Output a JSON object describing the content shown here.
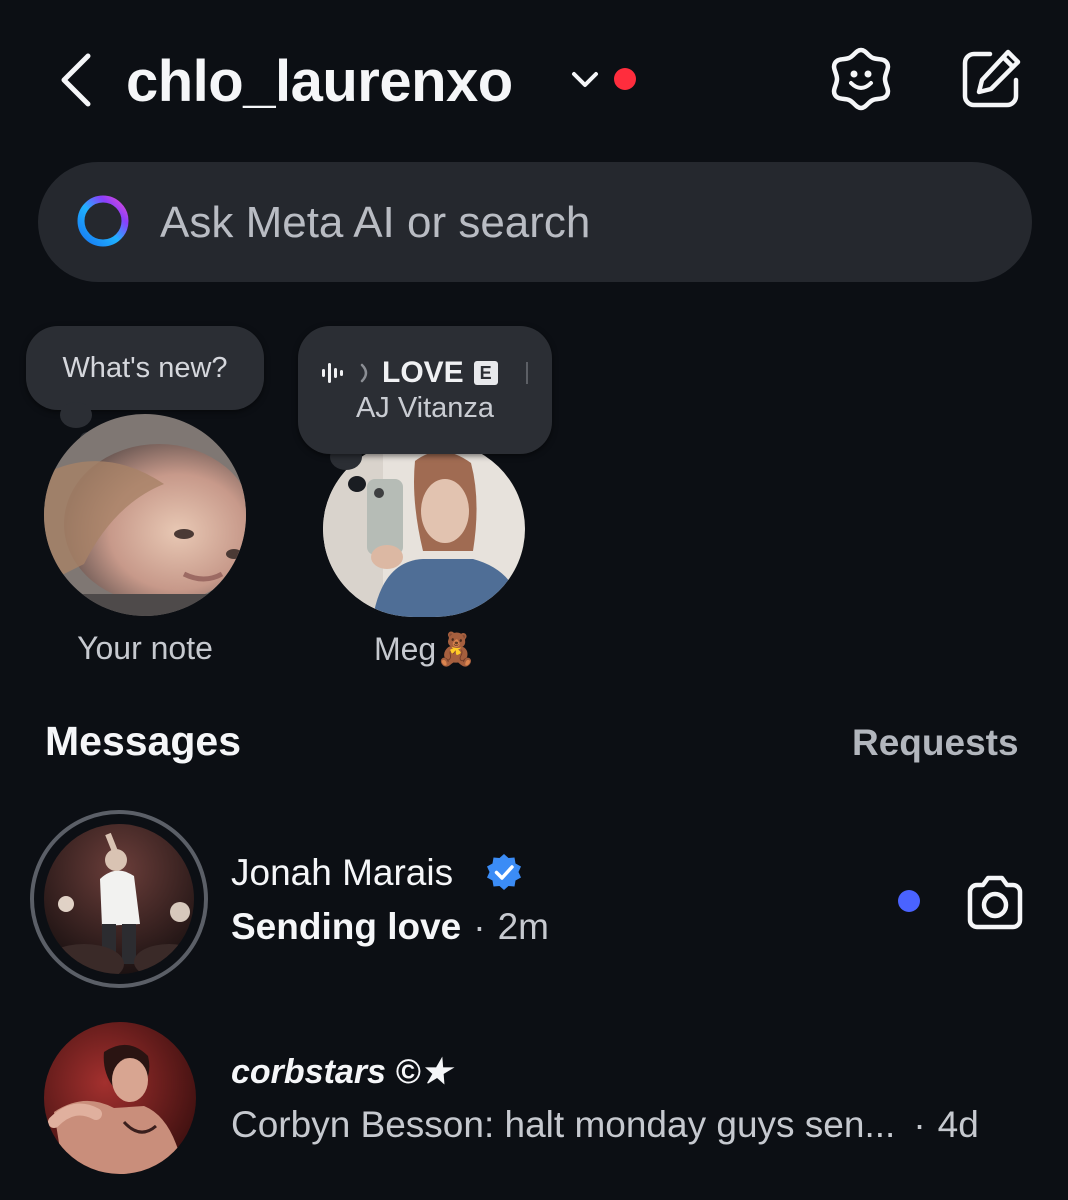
{
  "header": {
    "username": "chlo_laurenxo",
    "icons": {
      "back": "chevron-left-icon",
      "account_switch": "chevron-down-icon",
      "ai": "meta-ai-sparkle-icon",
      "compose": "compose-icon"
    },
    "notification_dot_color": "#ff2d3d"
  },
  "search": {
    "placeholder": "Ask Meta AI or search",
    "icon": "meta-ai-ring-icon"
  },
  "notes": [
    {
      "bubble_text": "What's new?",
      "label": "Your note"
    },
    {
      "song_title": "LOVE",
      "explicit_badge": "E",
      "artist": "AJ Vitanza",
      "label": "Meg🧸"
    }
  ],
  "messages": {
    "heading": "Messages",
    "requests_label": "Requests"
  },
  "conversations": [
    {
      "name": "Jonah Marais",
      "verified": true,
      "message": "Sending love",
      "separator": "·",
      "time": "2m",
      "unread": true,
      "unread_color": "#4a63ff",
      "action_icon": "camera-icon"
    },
    {
      "name": "corbstars ©★",
      "preview": "Corbyn Besson: halt monday guys sen...",
      "separator": "·",
      "time": "4d"
    }
  ],
  "colors": {
    "background": "#0c0f14",
    "search_background": "#25282e",
    "verified_blue": "#3b8cf6"
  }
}
